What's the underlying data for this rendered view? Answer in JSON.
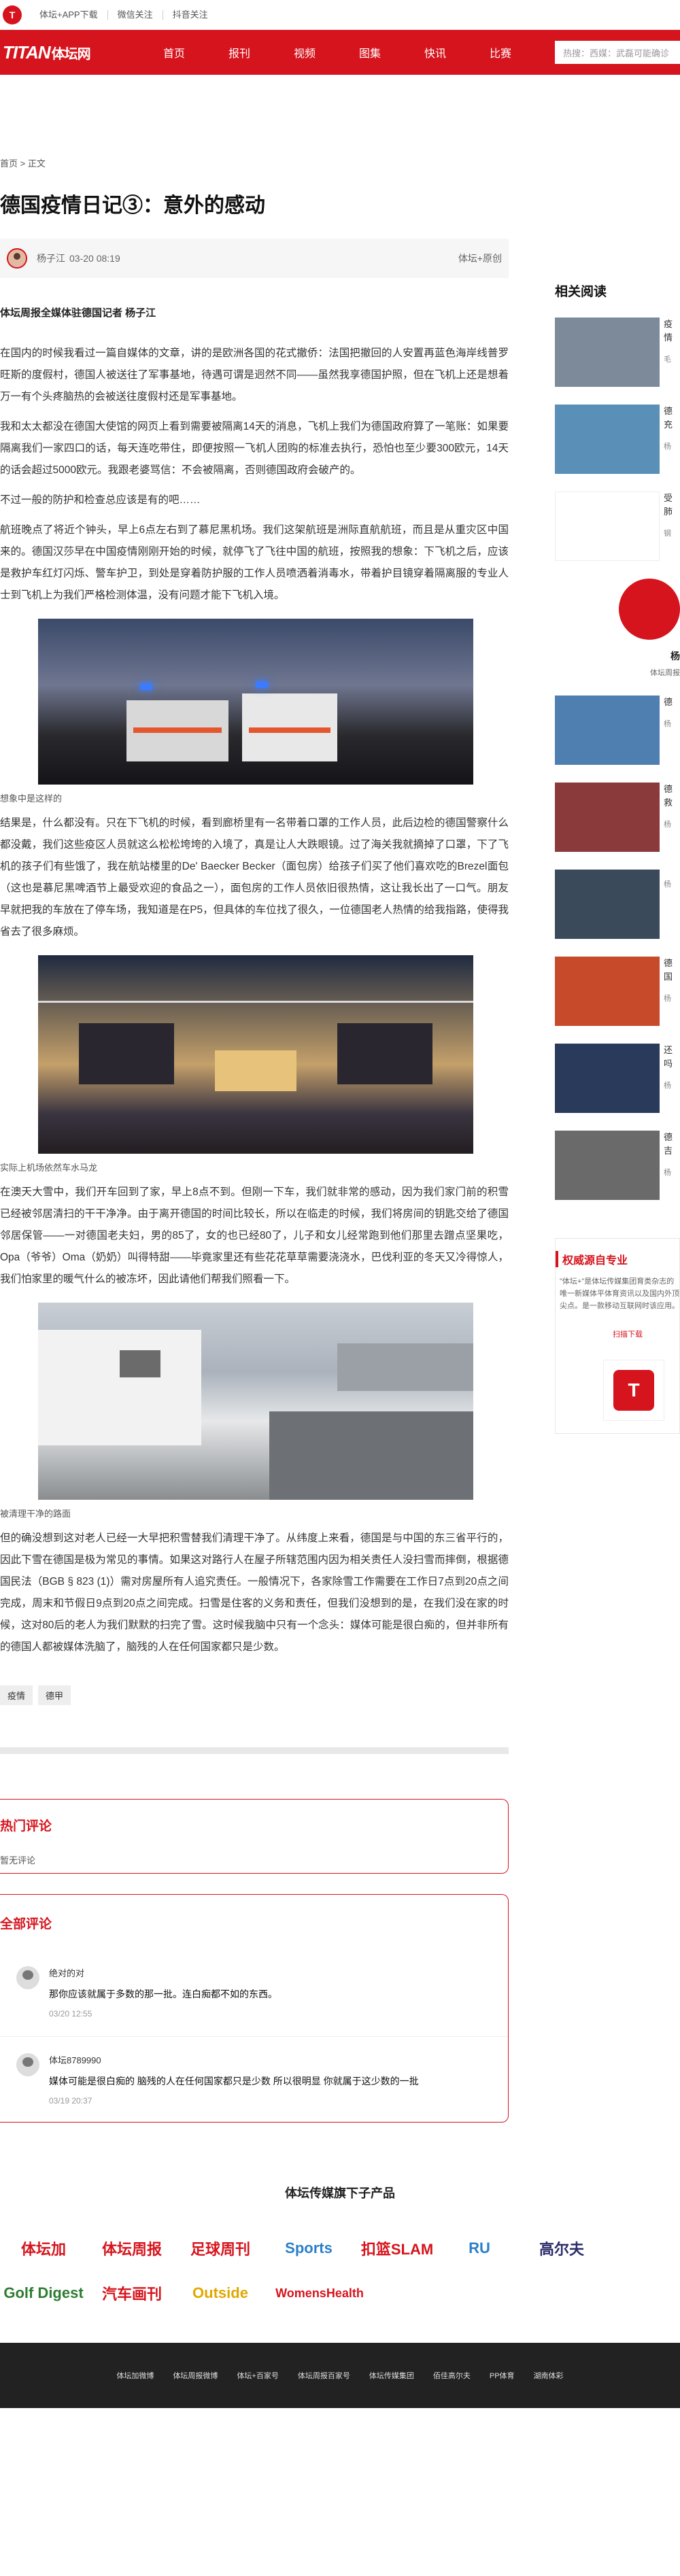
{
  "topbar": {
    "links": [
      "体坛+APP下载",
      "微信关注",
      "抖音关注"
    ]
  },
  "nav": {
    "brand": "TITAN",
    "brand_cn": "体坛网",
    "items": [
      "首页",
      "报刊",
      "视频",
      "图集",
      "快讯",
      "比赛"
    ],
    "search_placeholder": "热搜：西媒：武磊可能确诊"
  },
  "breadcrumb": {
    "home": "首页",
    "sep": ">",
    "current": "正文"
  },
  "article": {
    "title": "德国疫情日记③：意外的感动",
    "author": "杨子江",
    "time": "03-20 08:19",
    "source": "体坛+原创",
    "byline": "体坛周报全媒体驻德国记者 杨子江",
    "paragraphs": [
      "在国内的时候我看过一篇自媒体的文章，讲的是欧洲各国的花式撤侨：法国把撤回的人安置再蓝色海岸线普罗旺斯的度假村，德国人被送往了军事基地，待遇可谓是迥然不同——虽然我享德国护照，但在飞机上还是想着万一有个头疼脑热的会被送往度假村还是军事基地。",
      "我和太太都没在德国大使馆的网页上看到需要被隔离14天的消息，飞机上我们为德国政府算了一笔账：如果要隔离我们一家四口的话，每天连吃带住，即便按照一飞机人团购的标准去执行，恐怕也至少要300欧元，14天的话会超过5000欧元。我跟老婆骂信：不会被隔离，否则德国政府会破产的。",
      "不过一般的防护和检查总应该是有的吧……",
      "航班晚点了将近个钟头，早上6点左右到了慕尼黑机场。我们这架航班是洲际直航航班，而且是从重灾区中国来的。德国汉莎早在中国疫情刚刚开始的时候，就停飞了飞往中国的航班，按照我的想象：下飞机之后，应该是救护车红灯闪烁、警车护卫，到处是穿着防护服的工作人员喷洒着消毒水，带着护目镜穿着隔离服的专业人士到飞机上为我们严格检测体温，没有问题才能下飞机入境。",
      "结果是，什么都没有。只在下飞机的时候，看到廊桥里有一名带着口罩的工作人员，此后边检的德国警察什么都没戴，我们这些疫区人员就这么松松垮垮的入境了，真是让人大跌眼镜。过了海关我就摘掉了口罩，下了飞机的孩子们有些饿了，我在航站楼里的De' Baecker Becker（面包房）给孩子们买了他们喜欢吃的Brezel面包（这也是慕尼黑啤酒节上最受欢迎的食品之一），面包房的工作人员依旧很热情，这让我长出了一口气。朋友早就把我的车放在了停车场，我知道是在P5，但具体的车位找了很久，一位德国老人热情的给我指路，使得我省去了很多麻烦。",
      "在澳天大雪中，我们开车回到了家，早上8点不到。但刚一下车，我们就非常的感动，因为我们家门前的积雪已经被邻居清扫的干干净净。由于离开德国的时间比较长，所以在临走的时候，我们将房间的钥匙交给了德国邻居保管——一对德国老夫妇，男的85了，女的也已经80了，儿子和女儿经常跑到他们那里去蹭点坚果吃，Opa（爷爷）Oma（奶奶）叫得特甜——毕竟家里还有些花花草草需要浇浇水，巴伐利亚的冬天又冷得惊人，我们怕家里的暖气什么的被冻坏，因此请他们帮我们照看一下。",
      "但的确没想到这对老人已经一大早把积雪替我们清理干净了。从纬度上来看，德国是与中国的东三省平行的，因此下雪在德国是极为常见的事情。如果这对路行人在屋子所辖范围内因为相关责任人没扫雪而摔倒，根据德国民法（BGB § 823 (1)）需对房屋所有人追究责任。一般情况下，各家除雪工作需要在工作日7点到20点之间完成，周末和节假日9点到20点之间完成。扫雪是住客的义务和责任，但我们没想到的是，在我们没在家的时候，这对80后的老人为我们默默的扫完了雪。这时候我脑中只有一个念头：媒体可能是很白痴的，但并非所有的德国人都被媒体洗脑了，脑残的人在任何国家都只是少数。"
    ],
    "captions": [
      "想象中是这样的",
      "实际上机场依然车水马龙",
      "被清理干净的路面"
    ],
    "tags": [
      "疫情",
      "德甲"
    ]
  },
  "hot_comments": {
    "title": "热门评论",
    "empty": "暂无评论"
  },
  "all_comments": {
    "title": "全部评论",
    "items": [
      {
        "name": "绝对的对",
        "text": "那你应该就属于多数的那一批。连白痴都不如的东西。",
        "time": "03/20 12:55"
      },
      {
        "name": "体坛8789990",
        "text": "媒体可能是很白痴的 脑残的人在任何国家都只是少数 所以很明显 你就属于这少数的一批",
        "time": "03/19 20:37"
      }
    ]
  },
  "products": {
    "title": "体坛传媒旗下子产品",
    "logos": [
      {
        "name": "体坛加",
        "color": "#d6141d"
      },
      {
        "name": "体坛周报",
        "color": "#d6141d"
      },
      {
        "name": "足球周刊",
        "color": "#d6141d"
      },
      {
        "name": "Sports",
        "color": "#2a7fc9"
      },
      {
        "name": "扣篮SLAM",
        "color": "#d6141d"
      },
      {
        "name": "RU",
        "color": "#2a7fc9"
      },
      {
        "name": "高尔夫",
        "color": "#2b2b6a"
      },
      {
        "name": "Golf Digest",
        "color": "#2e7d32"
      },
      {
        "name": "汽车画刊",
        "color": "#d6141d"
      },
      {
        "name": "Outside",
        "color": "#e0a800"
      },
      {
        "name": "WomensHealth",
        "color": "#d6141d"
      }
    ]
  },
  "footer": {
    "links": [
      "体坛加微博",
      "体坛周报微博",
      "体坛+百家号",
      "体坛周报百家号",
      "体坛传媒集团",
      "佰佳高尔夫",
      "PP体育",
      "湖南体彩"
    ]
  },
  "sidebar": {
    "title": "相关阅读",
    "items_a": [
      {
        "text": "疫情",
        "sub": "毛",
        "thumb": "#7d8a9a"
      },
      {
        "text": "德充",
        "sub": "杨",
        "thumb": "#5a8fb8"
      },
      {
        "text": "受肺",
        "sub": "钢",
        "thumb": "#ffffff"
      }
    ],
    "profile_name": "杨",
    "profile_sub": "体坛周报",
    "items_b": [
      {
        "text": "德",
        "sub": "杨",
        "thumb": "#4f7fb0"
      },
      {
        "text": "德救",
        "sub": "杨",
        "thumb": "#8a3a3a"
      },
      {
        "text": "",
        "sub": "杨",
        "thumb": "#3a4a5a"
      },
      {
        "text": "德国",
        "sub": "杨",
        "thumb": "#c74a2a"
      },
      {
        "text": "还吗",
        "sub": "杨",
        "thumb": "#2a3a5a"
      },
      {
        "text": "德吉",
        "sub": "杨",
        "thumb": "#6a6a6a"
      }
    ],
    "auth_title": "权威源自专业",
    "auth_text": "\"体坛+\"是体坛传媒集团育类杂志的唯一新媒体平体育资讯以及国内外顶尖点。是一款移动互联网时该应用。",
    "qr_label": "扫描下载"
  }
}
